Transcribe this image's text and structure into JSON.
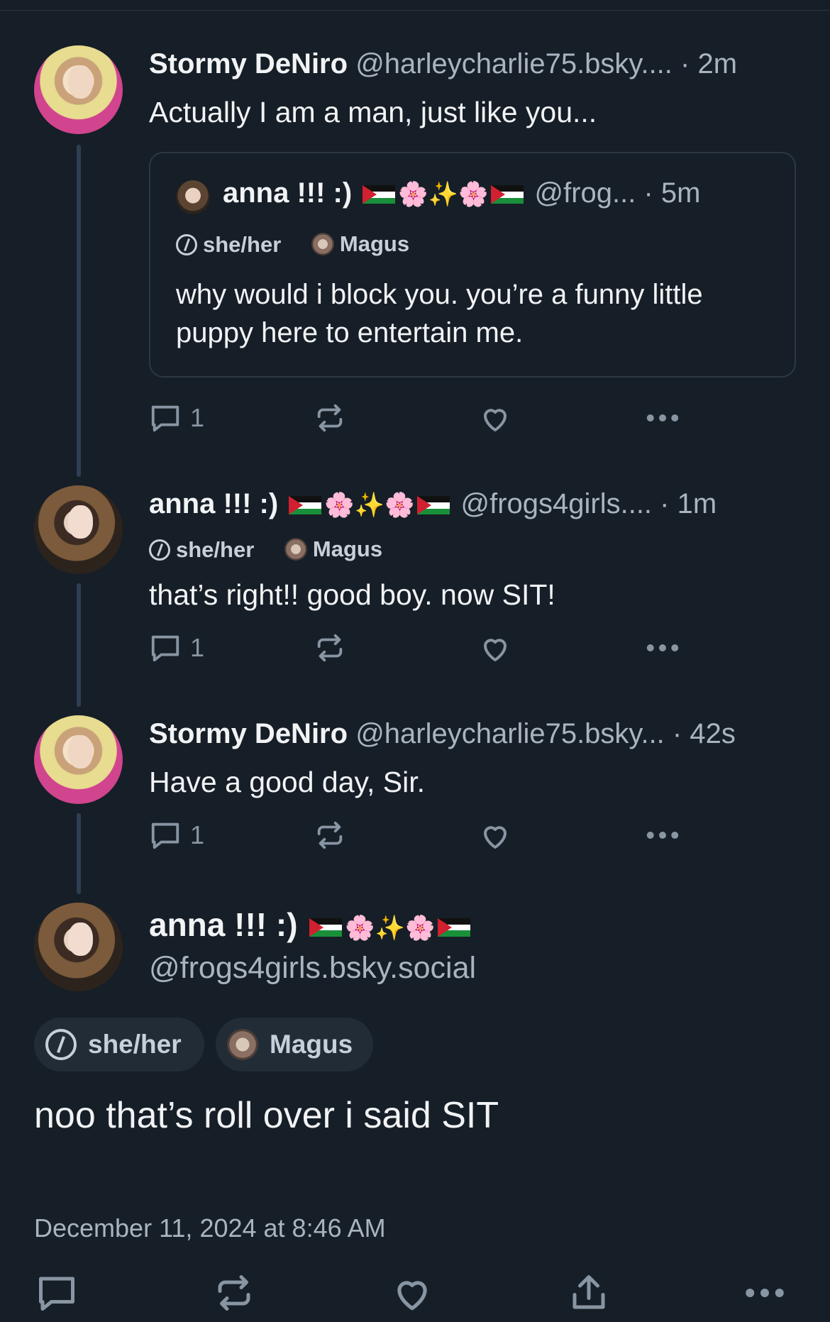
{
  "posts": [
    {
      "name": "Stormy DeNiro",
      "handle": "@harleycharlie75.bsky....",
      "time": "· 2m",
      "text": "Actually I am a man, just like you...",
      "quote": {
        "name": "anna !!! :)",
        "handle": "@frog...",
        "time": "· 5m",
        "pronouns": "she/her",
        "label": "Magus",
        "text": "why would i block you. you’re a funny little puppy here to entertain me."
      },
      "reply_count": "1"
    },
    {
      "name": "anna !!! :)",
      "handle": "@frogs4girls....",
      "time": "· 1m",
      "pronouns": "she/her",
      "label": "Magus",
      "text": "that’s right!! good boy. now SIT!",
      "reply_count": "1"
    },
    {
      "name": "Stormy DeNiro",
      "handle": "@harleycharlie75.bsky...",
      "time": "· 42s",
      "text": "Have a good day, Sir.",
      "reply_count": "1"
    }
  ],
  "main_post": {
    "name": "anna !!! :)",
    "handle": "@frogs4girls.bsky.social",
    "pronouns": "she/her",
    "label": "Magus",
    "text": "noo that’s roll over i said SIT",
    "timestamp": "December 11, 2024 at 8:46 AM"
  },
  "emoji": {
    "blossom": "🌸",
    "sparkles": "✨"
  },
  "icons": {
    "reply": "reply-icon",
    "repost": "repost-icon",
    "like": "heart-icon",
    "more": "more-icon",
    "share": "share-icon"
  },
  "colors": {
    "background": "#161e27",
    "text": "#f1f3f5",
    "muted": "#aab4c0",
    "thread_line": "#2e3f52",
    "pill_bg": "#222c37"
  }
}
